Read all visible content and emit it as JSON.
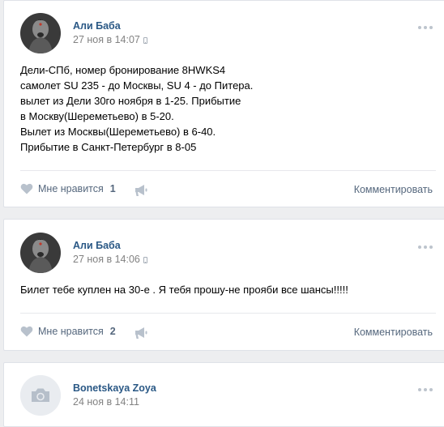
{
  "posts": [
    {
      "author": "Али Баба",
      "date": "27 ноя в 14:07",
      "text_lines": [
        "Дели-СПб, номер бронирование 8HWKS4",
        "самолет SU 235 - до Москвы, SU 4 - до Питера.",
        "вылет из Дели 30го ноября в 1-25. Прибытие",
        "в Москву(Шереметьево) в 5-20.",
        "Вылет из Москвы(Шереметьево) в 6-40.",
        "Прибытие в Санкт-Петербург в 8-05"
      ],
      "like_label": "Мне нравится",
      "like_count": "1",
      "comment_label": "Комментировать"
    },
    {
      "author": "Али Баба",
      "date": "27 ноя в 14:06",
      "text_lines": [
        "Билет тебе куплен на 30-е . Я тебя прошу-не прояби все шансы!!!!!"
      ],
      "like_label": "Мне нравится",
      "like_count": "2",
      "comment_label": "Комментировать"
    },
    {
      "author": "Bonetskaya Zoya",
      "date": "24 ноя в 14:11"
    }
  ],
  "colors": {
    "link": "#2a5885",
    "secondary": "#828282",
    "action": "#55677d",
    "background": "#edeef0"
  },
  "icons": {
    "more": "more-dots-icon",
    "like": "heart-icon",
    "share": "megaphone-icon",
    "device": "mobile-phone-icon",
    "camera": "camera-icon"
  }
}
